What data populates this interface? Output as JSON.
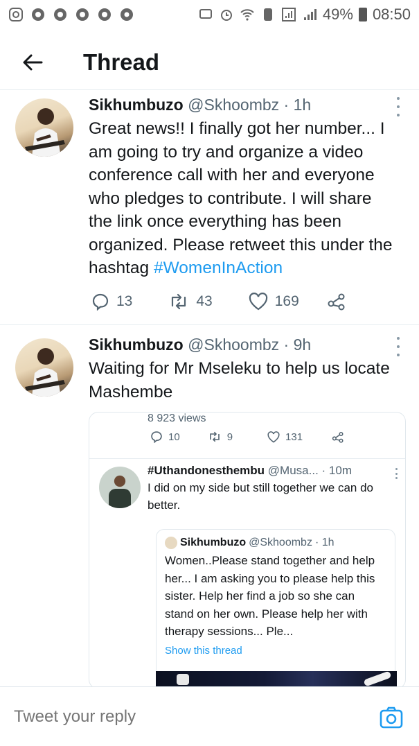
{
  "status_bar": {
    "battery": "49%",
    "time": "08:50"
  },
  "header": {
    "title": "Thread"
  },
  "tweets": [
    {
      "author_name": "Sikhumbuzo",
      "handle": "@Skhoombz",
      "time": "· 1h",
      "text_before_hashtag": "Great news!! I finally got her number... I am going to try and organize a video conference call with her and everyone who pledges to contribute.   I will share the link once everything has been organized. Please retweet this under the hashtag ",
      "hashtag": "#WomenInAction",
      "replies": "13",
      "retweets": "43",
      "likes": "169"
    },
    {
      "author_name": "Sikhumbuzo",
      "handle": "@Skhoombz",
      "time": "· 9h",
      "text": "Waiting for Mr Mseleku to help us locate Mashembe",
      "embed": {
        "views": "8 923 views",
        "replies": "10",
        "retweets": "9",
        "likes": "131",
        "reply": {
          "author_name": "#Uthandonesthembu",
          "handle": "@Musa...",
          "time": "· 10m",
          "text": "I did on my side but still together we can do better."
        },
        "quote": {
          "author_name": "Sikhumbuzo",
          "handle": "@Skhoombz",
          "time": "· 1h",
          "text": "Women..Please stand together and help her... I am asking you to please help this sister. Help her find a job so she can stand on her own. Please help her with therapy sessions... Ple...",
          "show_thread": "Show this thread"
        }
      }
    }
  ],
  "reply_bar": {
    "placeholder": "Tweet your reply"
  },
  "colors": {
    "accent": "#1d9bf0",
    "text": "#14171a",
    "muted": "#536471"
  }
}
